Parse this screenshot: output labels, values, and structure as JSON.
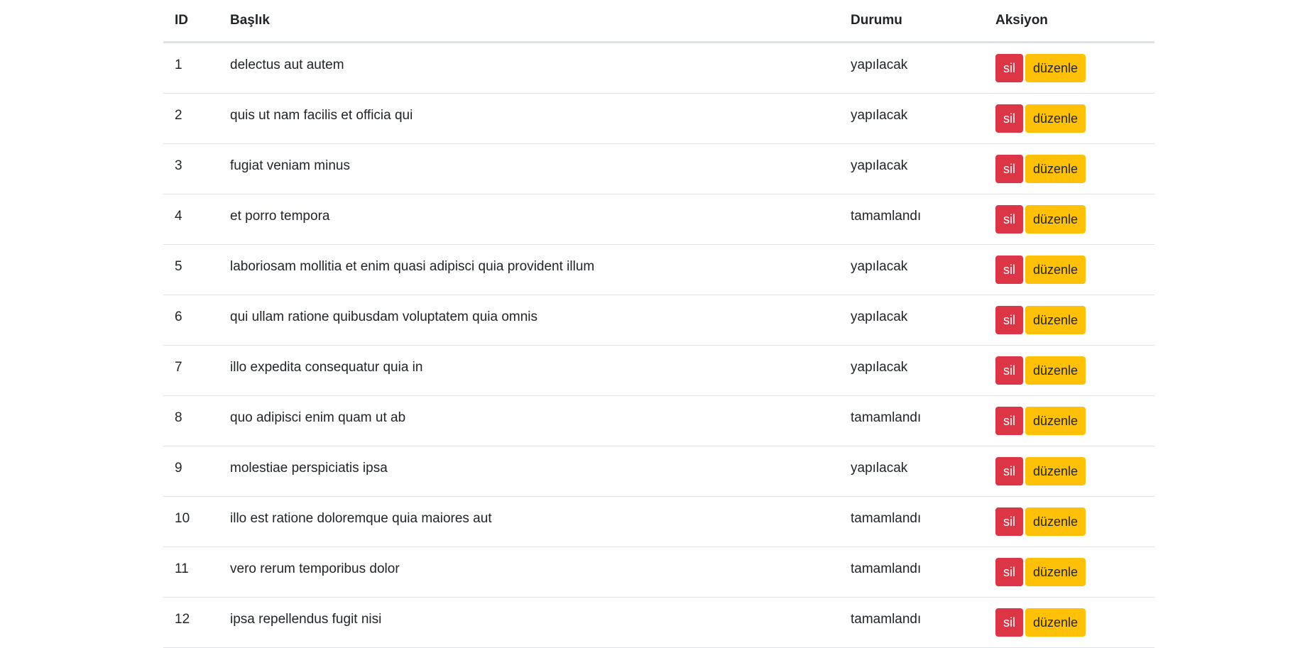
{
  "table": {
    "headers": {
      "id": "ID",
      "title": "Başlık",
      "status": "Durumu",
      "action": "Aksiyon"
    },
    "rows": [
      {
        "id": "1",
        "title": "delectus aut autem",
        "status": "yapılacak",
        "delete_label": "sil",
        "edit_label": "düzenle"
      },
      {
        "id": "2",
        "title": "quis ut nam facilis et officia qui",
        "status": "yapılacak",
        "delete_label": "sil",
        "edit_label": "düzenle"
      },
      {
        "id": "3",
        "title": "fugiat veniam minus",
        "status": "yapılacak",
        "delete_label": "sil",
        "edit_label": "düzenle"
      },
      {
        "id": "4",
        "title": "et porro tempora",
        "status": "tamamlandı",
        "delete_label": "sil",
        "edit_label": "düzenle"
      },
      {
        "id": "5",
        "title": "laboriosam mollitia et enim quasi adipisci quia provident illum",
        "status": "yapılacak",
        "delete_label": "sil",
        "edit_label": "düzenle"
      },
      {
        "id": "6",
        "title": "qui ullam ratione quibusdam voluptatem quia omnis",
        "status": "yapılacak",
        "delete_label": "sil",
        "edit_label": "düzenle"
      },
      {
        "id": "7",
        "title": "illo expedita consequatur quia in",
        "status": "yapılacak",
        "delete_label": "sil",
        "edit_label": "düzenle"
      },
      {
        "id": "8",
        "title": "quo adipisci enim quam ut ab",
        "status": "tamamlandı",
        "delete_label": "sil",
        "edit_label": "düzenle"
      },
      {
        "id": "9",
        "title": "molestiae perspiciatis ipsa",
        "status": "yapılacak",
        "delete_label": "sil",
        "edit_label": "düzenle"
      },
      {
        "id": "10",
        "title": "illo est ratione doloremque quia maiores aut",
        "status": "tamamlandı",
        "delete_label": "sil",
        "edit_label": "düzenle"
      },
      {
        "id": "11",
        "title": "vero rerum temporibus dolor",
        "status": "tamamlandı",
        "delete_label": "sil",
        "edit_label": "düzenle"
      },
      {
        "id": "12",
        "title": "ipsa repellendus fugit nisi",
        "status": "tamamlandı",
        "delete_label": "sil",
        "edit_label": "düzenle"
      }
    ]
  },
  "colors": {
    "delete_button": "#dc3545",
    "edit_button": "#ffc107",
    "text": "#212529",
    "divider": "#dee2e6"
  }
}
